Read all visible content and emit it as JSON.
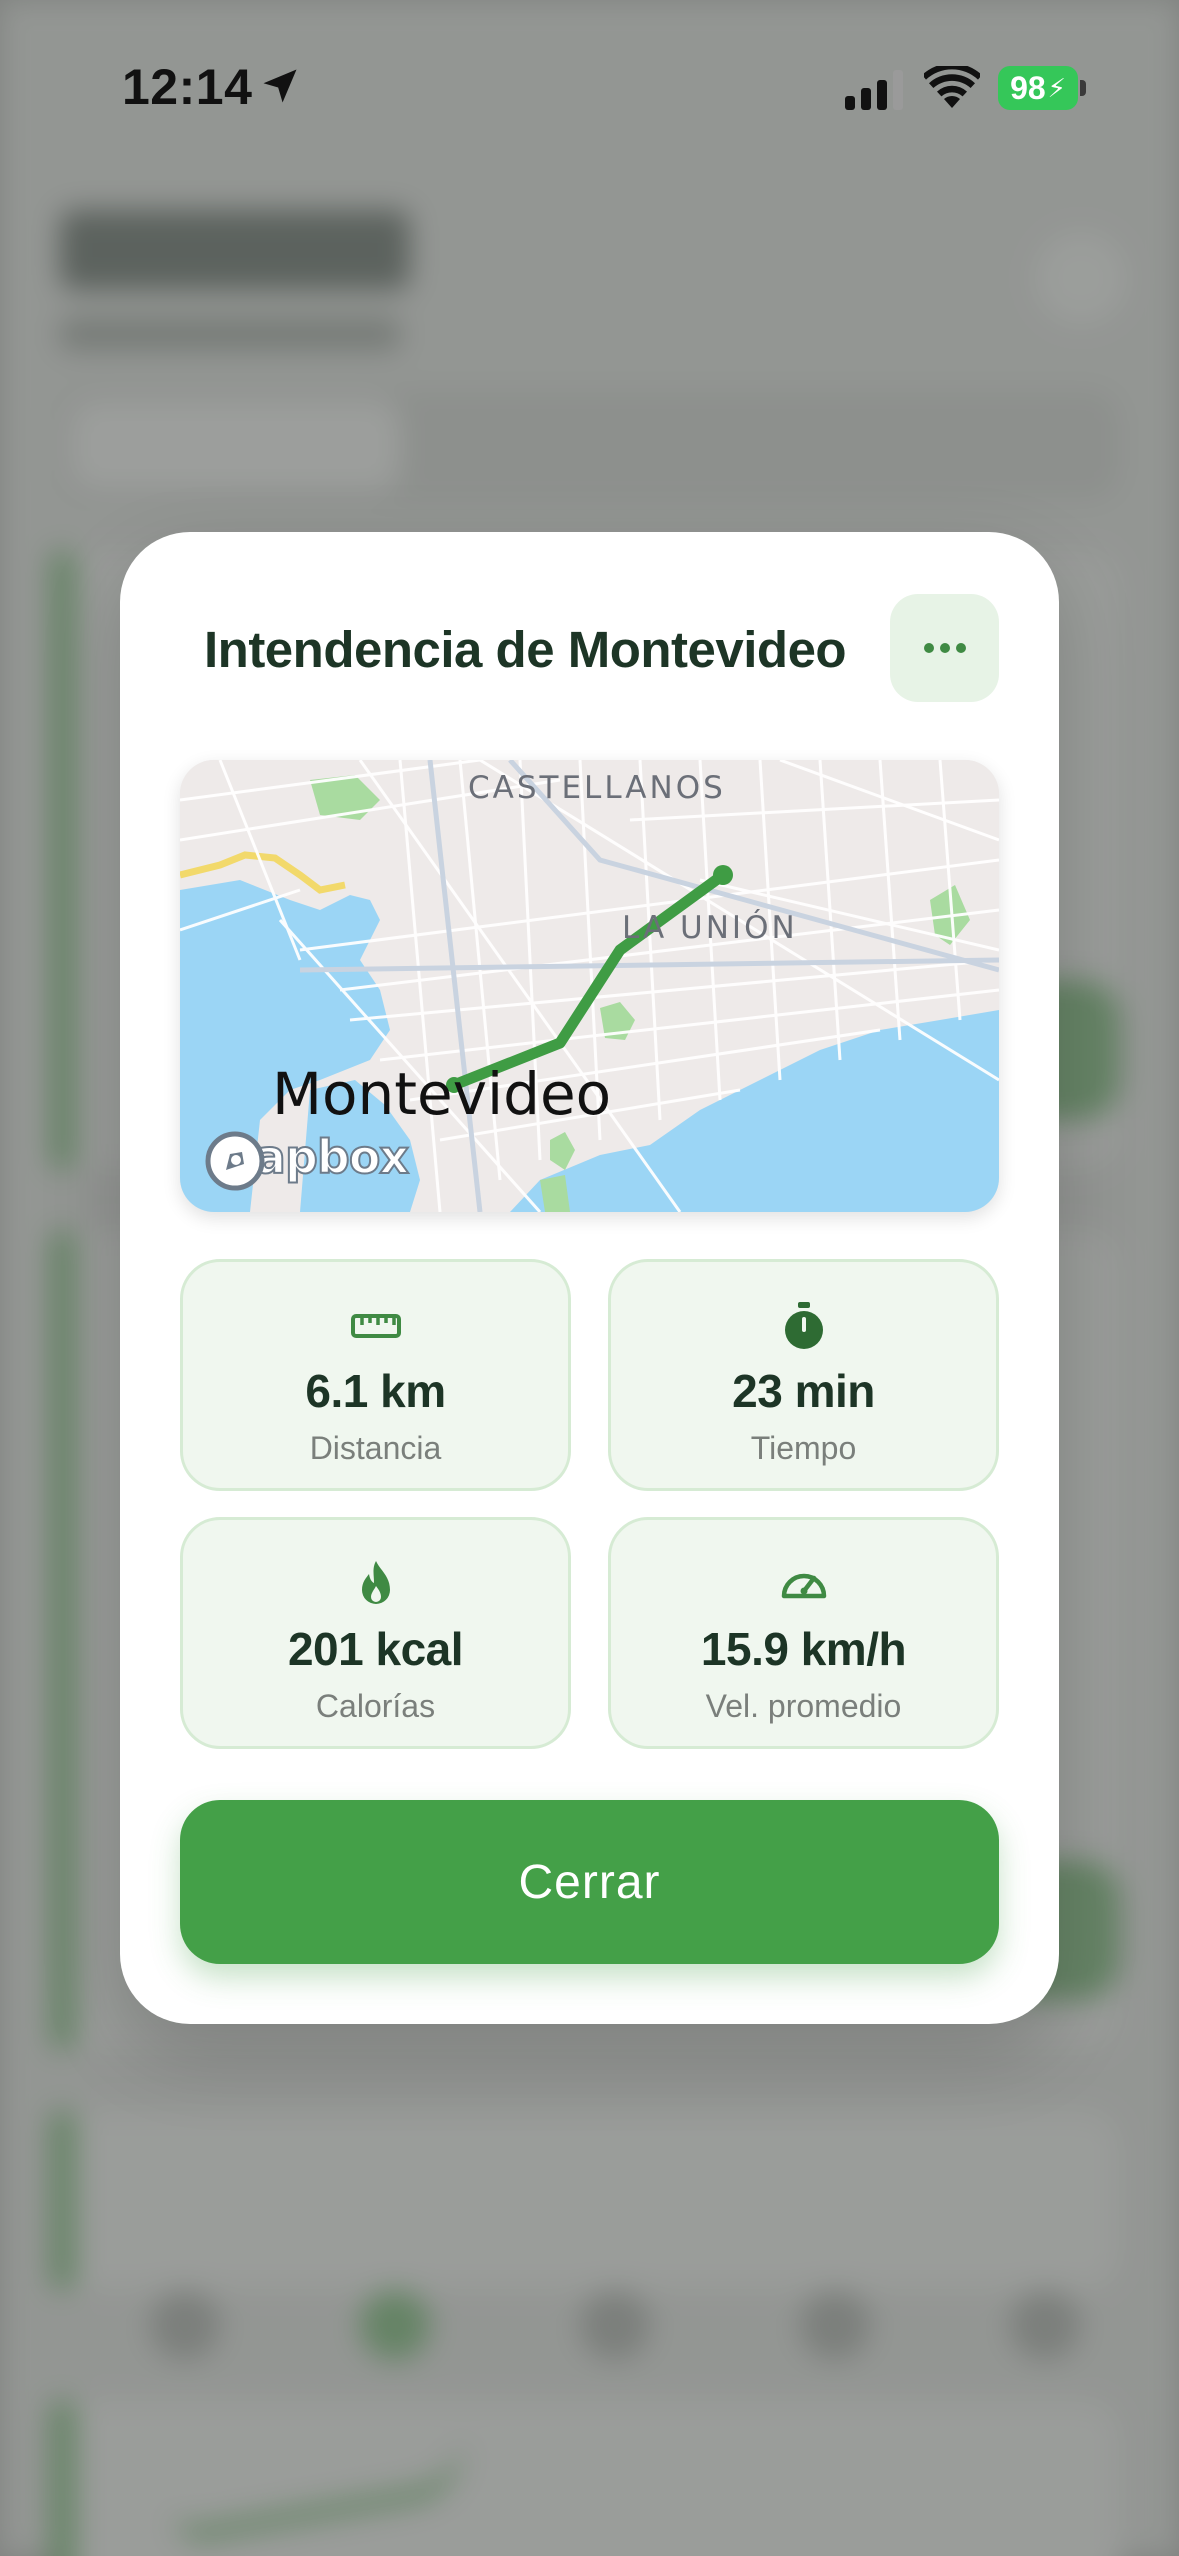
{
  "status_bar": {
    "time": "12:14",
    "battery_level": "98",
    "icons": [
      "location-arrow-icon",
      "cellular-signal-icon",
      "wifi-icon",
      "battery-charging-icon"
    ]
  },
  "modal": {
    "title": "Intendencia de Montevideo",
    "menu_icon": "ellipsis-icon",
    "map": {
      "labels": {
        "top": "CASTELLANOS",
        "neighborhood": "LA UNIÓN",
        "city": "Montevideo"
      },
      "attribution": "mapbox",
      "route_color": "#3f9c44"
    },
    "stats": [
      {
        "icon": "ruler-icon",
        "value": "6.1 km",
        "label": "Distancia"
      },
      {
        "icon": "stopwatch-icon",
        "value": "23 min",
        "label": "Tiempo"
      },
      {
        "icon": "flame-icon",
        "value": "201 kcal",
        "label": "Calorías"
      },
      {
        "icon": "speedometer-icon",
        "value": "15.9 km/h",
        "label": "Vel. promedio"
      }
    ],
    "close_button_label": "Cerrar"
  },
  "colors": {
    "accent_green": "#44a048",
    "title_dark_green": "#1d3526",
    "stat_card_bg": "#f0f7ef",
    "battery_green": "#35c759"
  }
}
